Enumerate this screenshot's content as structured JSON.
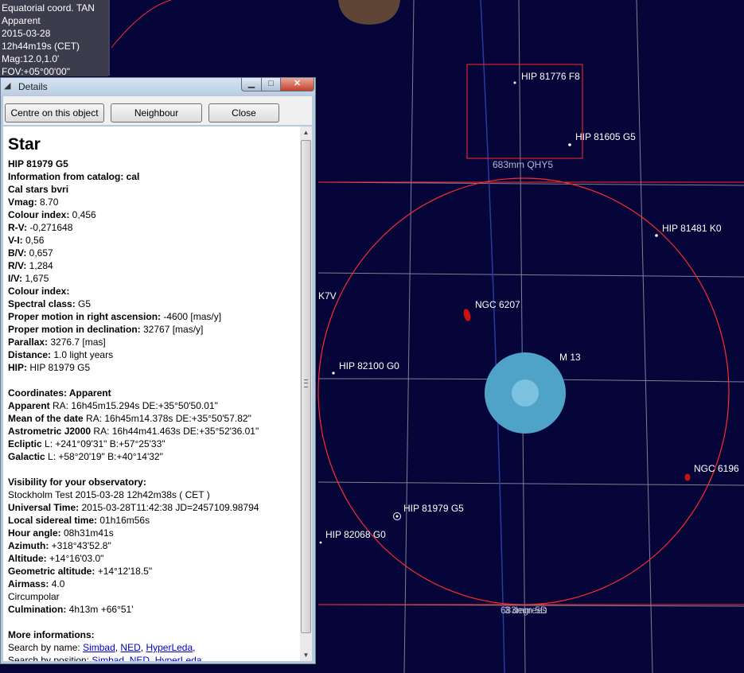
{
  "sky": {
    "labels": {
      "hip81776": "HIP 81776 F8",
      "hip81605": "HIP 81605 G5",
      "fov_small": "683mm QHY5",
      "hip81481": "HIP 81481 K0",
      "k7v": "K7V",
      "ngc6207": "NGC 6207",
      "m13": "M 13",
      "hip82100": "HIP 82100 G0",
      "ngc6196": "NGC 6196",
      "hip81979": "HIP 81979 G5",
      "hip82068": "HIP 82068 G0",
      "fov_bottom": "683mm 5D",
      "fov_bottom2": "3 degrees"
    },
    "colors": {
      "background": "#05053a",
      "fov_frame": "#ff2a2a",
      "cluster": "#4fa3c8",
      "galaxy": "#cc1111"
    }
  },
  "overlay": {
    "lines": [
      "Equatorial coord. TAN",
      "Apparent",
      "2015-03-28",
      "12h44m19s (CET)",
      "Mag:12.0,1.0'",
      "FOV:+05°00'00\""
    ]
  },
  "window": {
    "title": "Details",
    "buttons": {
      "centre": "Centre on this object",
      "neighbour": "Neighbour",
      "close": "Close"
    }
  },
  "details": {
    "heading": "Star",
    "name": "HIP 81979 G5",
    "catalog": "Information from catalog: cal",
    "catalog_name": "Cal stars bvri",
    "rows": [
      {
        "k": "Vmag:",
        "v": " 8.70"
      },
      {
        "k": "Colour index:",
        "v": " 0,456"
      },
      {
        "k": "R-V:",
        "v": " -0,271648"
      },
      {
        "k": "V-I:",
        "v": " 0,56"
      },
      {
        "k": "B/V:",
        "v": " 0,657"
      },
      {
        "k": "R/V:",
        "v": " 1,284"
      },
      {
        "k": "I/V:",
        "v": " 1,675"
      },
      {
        "k": "Colour index:",
        "v": ""
      },
      {
        "k": "Spectral class:",
        "v": " G5"
      },
      {
        "k": "Proper motion in right ascension:",
        "v": " -4600 [mas/y]"
      },
      {
        "k": "Proper motion in declination:",
        "v": " 32767 [mas/y]"
      },
      {
        "k": "Parallax:",
        "v": " 3276.7 [mas]"
      },
      {
        "k": "Distance:",
        "v": " 1.0 light years"
      },
      {
        "k": "HIP:",
        "v": " HIP 81979 G5"
      }
    ],
    "coords_title": "Coordinates: Apparent",
    "coords": [
      {
        "k": "Apparent",
        "v": " RA: 16h45m15.294s DE:+35°50'50.01\""
      },
      {
        "k": "Mean of the date",
        "v": " RA: 16h45m14.378s DE:+35°50'57.82\""
      },
      {
        "k": "Astrometric J2000",
        "v": " RA: 16h44m41.463s DE:+35°52'36.01\""
      },
      {
        "k": "Ecliptic",
        "v": "  L: +241°09'31\" B:+57°25'33\""
      },
      {
        "k": "Galactic",
        "v": "  L: +58°20'19\" B:+40°14'32\""
      }
    ],
    "vis_title": "Visibility for your observatory:",
    "observatory": "Stockholm Test 2015-03-28 12h42m38s ( CET )",
    "vis": [
      {
        "k": "Universal Time:",
        "v": " 2015-03-28T11:42:38 JD=2457109.98794"
      },
      {
        "k": "Local sidereal time:",
        "v": " 01h16m56s"
      },
      {
        "k": "Hour angle:",
        "v": " 08h31m41s"
      },
      {
        "k": "Azimuth:",
        "v": " +318°43'52.8\""
      },
      {
        "k": "Altitude:",
        "v": " +14°16'03.0\""
      },
      {
        "k": "Geometric altitude:",
        "v": " +14°12'18.5\""
      },
      {
        "k": "Airmass:",
        "v": " 4.0"
      }
    ],
    "circumpolar": "Circumpolar",
    "culmination_k": "Culmination:",
    "culmination_v": " 4h13m +66°51'",
    "more_title": "More informations:",
    "search_name_label": "Search by name: ",
    "search_links": [
      "Simbad",
      "NED",
      "HyperLeda"
    ],
    "search_pos_label": "Search by position: "
  }
}
